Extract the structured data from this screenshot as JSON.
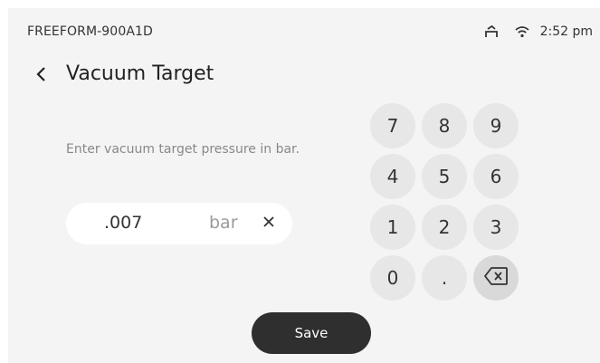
{
  "status_bar": {
    "device_name": "FREEFORM-900A1D",
    "time": "2:52 pm",
    "icons": [
      "tray-icon",
      "wifi-icon"
    ]
  },
  "header": {
    "title": "Vacuum Target",
    "back_icon": "chevron-left-icon"
  },
  "form": {
    "instructions": "Enter vacuum target pressure in bar.",
    "value": ".007",
    "unit": "bar",
    "clear_icon": "close-icon"
  },
  "keypad": {
    "keys": [
      "7",
      "8",
      "9",
      "4",
      "5",
      "6",
      "1",
      "2",
      "3",
      "0",
      "."
    ],
    "backspace_icon": "backspace-icon"
  },
  "actions": {
    "save_label": "Save"
  },
  "colors": {
    "background": "#f4f4f4",
    "key": "#e7e7e7",
    "primary_button": "#2f2f2f"
  }
}
